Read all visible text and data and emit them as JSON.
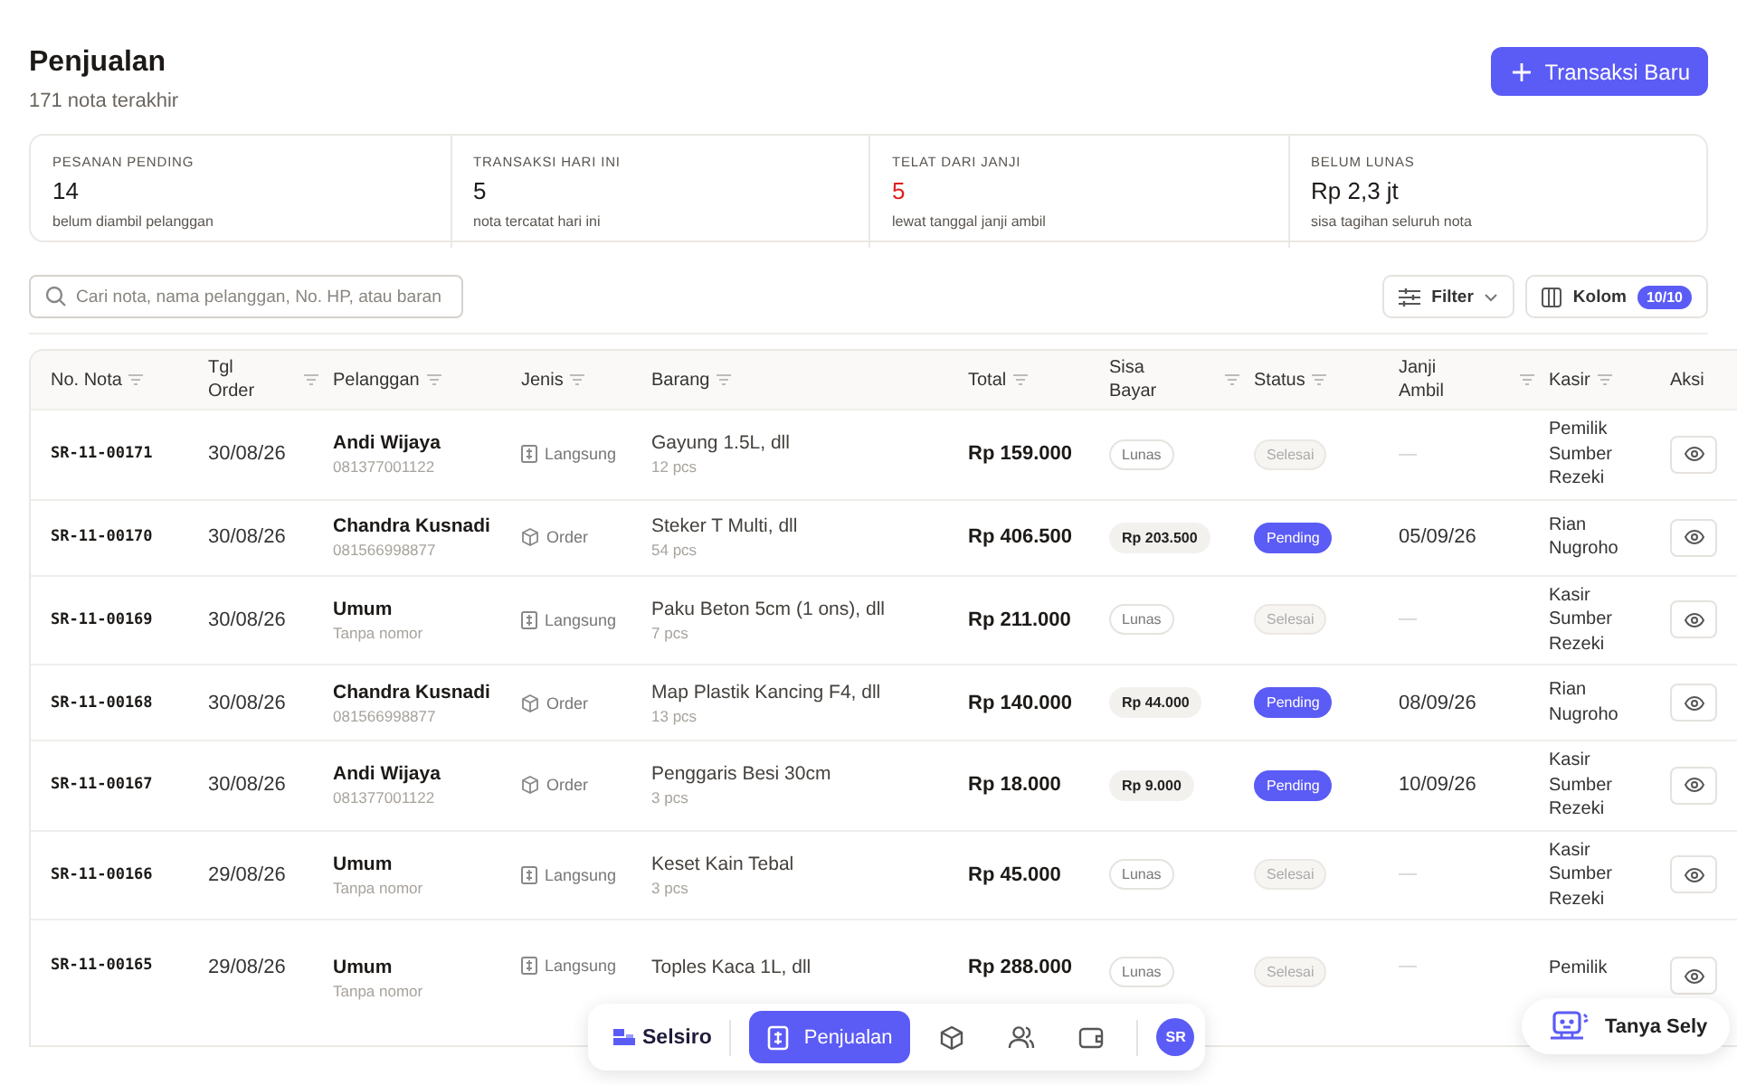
{
  "header": {
    "title": "Penjualan",
    "subtitle": "171 nota terakhir",
    "new_button": "Transaksi Baru"
  },
  "stats": [
    {
      "label": "PESANAN PENDING",
      "value": "14",
      "note": "belum diambil pelanggan",
      "alert": false
    },
    {
      "label": "TRANSAKSI HARI INI",
      "value": "5",
      "note": "nota tercatat hari ini",
      "alert": false
    },
    {
      "label": "TELAT DARI JANJI",
      "value": "5",
      "note": "lewat tanggal janji ambil",
      "alert": true
    },
    {
      "label": "BELUM LUNAS",
      "value": "Rp 2,3 jt",
      "note": "sisa tagihan seluruh nota",
      "alert": false
    }
  ],
  "toolbar": {
    "search_placeholder": "Cari nota, nama pelanggan, No. HP, atau baran",
    "filter": "Filter",
    "columns": "Kolom",
    "columns_count": "10/10"
  },
  "table": {
    "columns": [
      "No. Nota",
      "Tgl Order",
      "Pelanggan",
      "Jenis",
      "Barang",
      "Total",
      "Sisa Bayar",
      "Status",
      "Janji Ambil",
      "Kasir",
      "Aksi"
    ],
    "rows": [
      {
        "nota": "SR-11-00171",
        "date": "30/08/26",
        "customer": "Andi Wijaya",
        "phone": "081377001122",
        "type": {
          "kind": "langsung",
          "label": "Langsung"
        },
        "item": "Gayung 1.5L, dll",
        "qty": "12 pcs",
        "total": "Rp 159.000",
        "due": {
          "kind": "paid",
          "text": "Lunas"
        },
        "status": {
          "kind": "done",
          "text": "Selesai"
        },
        "pickup": "—",
        "cashier": "Pemilik Sumber Rezeki"
      },
      {
        "nota": "SR-11-00170",
        "date": "30/08/26",
        "customer": "Chandra Kusnadi",
        "phone": "081566998877",
        "type": {
          "kind": "order",
          "label": "Order"
        },
        "item": "Steker T Multi, dll",
        "qty": "54 pcs",
        "total": "Rp 406.500",
        "due": {
          "kind": "owed",
          "text": "Rp 203.500"
        },
        "status": {
          "kind": "pending",
          "text": "Pending"
        },
        "pickup": "05/09/26",
        "cashier": "Rian Nugroho"
      },
      {
        "nota": "SR-11-00169",
        "date": "30/08/26",
        "customer": "Umum",
        "phone": "Tanpa nomor",
        "type": {
          "kind": "langsung",
          "label": "Langsung"
        },
        "item": "Paku Beton 5cm (1 ons), dll",
        "qty": "7 pcs",
        "total": "Rp 211.000",
        "due": {
          "kind": "paid",
          "text": "Lunas"
        },
        "status": {
          "kind": "done",
          "text": "Selesai"
        },
        "pickup": "—",
        "cashier": "Kasir Sumber Rezeki"
      },
      {
        "nota": "SR-11-00168",
        "date": "30/08/26",
        "customer": "Chandra Kusnadi",
        "phone": "081566998877",
        "type": {
          "kind": "order",
          "label": "Order"
        },
        "item": "Map Plastik Kancing F4, dll",
        "qty": "13 pcs",
        "total": "Rp 140.000",
        "due": {
          "kind": "owed",
          "text": "Rp 44.000"
        },
        "status": {
          "kind": "pending",
          "text": "Pending"
        },
        "pickup": "08/09/26",
        "cashier": "Rian Nugroho"
      },
      {
        "nota": "SR-11-00167",
        "date": "30/08/26",
        "customer": "Andi Wijaya",
        "phone": "081377001122",
        "type": {
          "kind": "order",
          "label": "Order"
        },
        "item": "Penggaris Besi 30cm",
        "qty": "3 pcs",
        "total": "Rp 18.000",
        "due": {
          "kind": "owed",
          "text": "Rp 9.000"
        },
        "status": {
          "kind": "pending",
          "text": "Pending"
        },
        "pickup": "10/09/26",
        "cashier": "Kasir Sumber Rezeki"
      },
      {
        "nota": "SR-11-00166",
        "date": "29/08/26",
        "customer": "Umum",
        "phone": "Tanpa nomor",
        "type": {
          "kind": "langsung",
          "label": "Langsung"
        },
        "item": "Keset Kain Tebal",
        "qty": "3 pcs",
        "total": "Rp 45.000",
        "due": {
          "kind": "paid",
          "text": "Lunas"
        },
        "status": {
          "kind": "done",
          "text": "Selesai"
        },
        "pickup": "—",
        "cashier": "Kasir Sumber Rezeki"
      },
      {
        "nota": "SR-11-00165",
        "date": "29/08/26",
        "customer": "Umum",
        "phone": "Tanpa nomor",
        "type": {
          "kind": "langsung",
          "label": "Langsung"
        },
        "item": "Toples Kaca 1L, dll",
        "total": "Rp 288.000",
        "due": {
          "kind": "paid",
          "text": "Lunas"
        },
        "status": {
          "kind": "done",
          "text": "Selesai"
        },
        "pickup": "—",
        "cashier": "Pemilik"
      }
    ]
  },
  "bottom_nav": {
    "brand": "Selsiro",
    "items": [
      {
        "kind": "sales",
        "label": "Penjualan",
        "selected": true
      },
      {
        "kind": "products",
        "selected": false
      },
      {
        "kind": "customers",
        "selected": false
      },
      {
        "kind": "wallet",
        "selected": false
      }
    ],
    "avatar": "SR"
  },
  "assistant": {
    "label": "Tanya Sely"
  }
}
